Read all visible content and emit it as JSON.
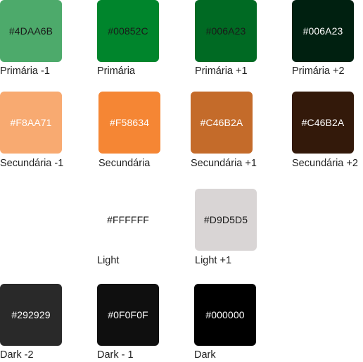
{
  "swatches": [
    {
      "hex_text": "#4DAA6B",
      "label": "Primária -1",
      "color": "#4DAA6B",
      "text_color": "#1a1a1a"
    },
    {
      "hex_text": "#00852C",
      "label": "Primária",
      "color": "#00852C",
      "text_color": "#1a1a1a"
    },
    {
      "hex_text": "#006A23",
      "label": "Primária +1",
      "color": "#006A23",
      "text_color": "#1a1a1a"
    },
    {
      "hex_text": "#006A23",
      "label": "Primária +2",
      "color": "#002010",
      "text_color": "#ffffff"
    },
    {
      "hex_text": "#F8AA71",
      "label": "Secundária -1",
      "color": "#F8AA71",
      "text_color": "#ffffff"
    },
    {
      "hex_text": "#F58634",
      "label": "Secundária",
      "color": "#F58634",
      "text_color": "#ffffff"
    },
    {
      "hex_text": "#C46B2A",
      "label": "Secundária +1",
      "color": "#C46B2A",
      "text_color": "#ffffff"
    },
    {
      "hex_text": "#C46B2A",
      "label": "Secundária +2",
      "color": "#33190A",
      "text_color": "#ffffff"
    },
    {
      "hex_text": "#FFFFFF",
      "label": "Light",
      "color": "#FFFFFF",
      "text_color": "#1a1a1a"
    },
    {
      "hex_text": "#D9D5D5",
      "label": "Light +1",
      "color": "#D9D5D5",
      "text_color": "#1a1a1a"
    },
    {
      "hex_text": "#292929",
      "label": "Dark -2",
      "color": "#292929",
      "text_color": "#ffffff"
    },
    {
      "hex_text": "#0F0F0F",
      "label": "Dark - 1",
      "color": "#0F0F0F",
      "text_color": "#ffffff"
    },
    {
      "hex_text": "#000000",
      "label": "Dark",
      "color": "#000000",
      "text_color": "#ffffff"
    }
  ]
}
